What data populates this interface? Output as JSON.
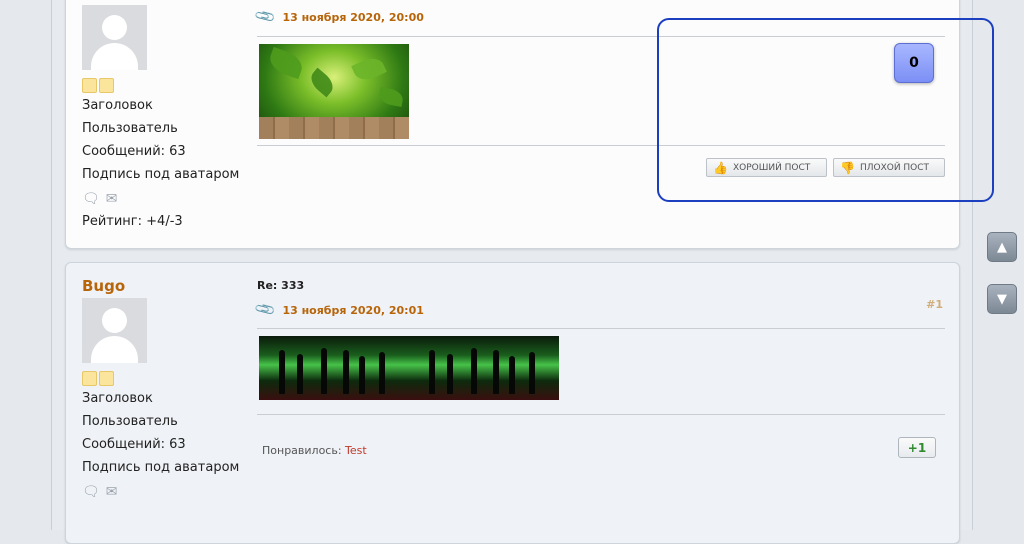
{
  "posts": [
    {
      "author": {
        "group": "Заголовок",
        "role": "Пользователь",
        "messages": "Сообщений: 63",
        "signature": "Подпись под аватаром",
        "rating": "Рейтинг: +4/-3"
      },
      "date": "13 ноября 2020, 20:00",
      "vote_count": "0",
      "good_post_label": "ХОРОШИЙ ПОСТ",
      "bad_post_label": "ПЛОХОЙ ПОСТ"
    },
    {
      "author": {
        "name": "Bugo",
        "group": "Заголовок",
        "role": "Пользователь",
        "messages": "Сообщений: 63",
        "signature": "Подпись под аватаром"
      },
      "subject": "Re: 333",
      "date": "13 ноября 2020, 20:01",
      "post_number": "#1",
      "liked_label": "Понравилось:",
      "liked_user": "Test",
      "plus_count": "+1"
    }
  ],
  "icons": {
    "attachment": "paperclip-icon",
    "pm": "envelope-icon",
    "chat": "speech-bubble-icon",
    "scroll_up": "chevron-up-icon",
    "scroll_down": "chevron-down-icon"
  },
  "colors": {
    "author_name": "#b8650a",
    "vote_box": "#8b9cf8",
    "highlight": "#1b3fbf",
    "plus": "#2e8b2e"
  }
}
